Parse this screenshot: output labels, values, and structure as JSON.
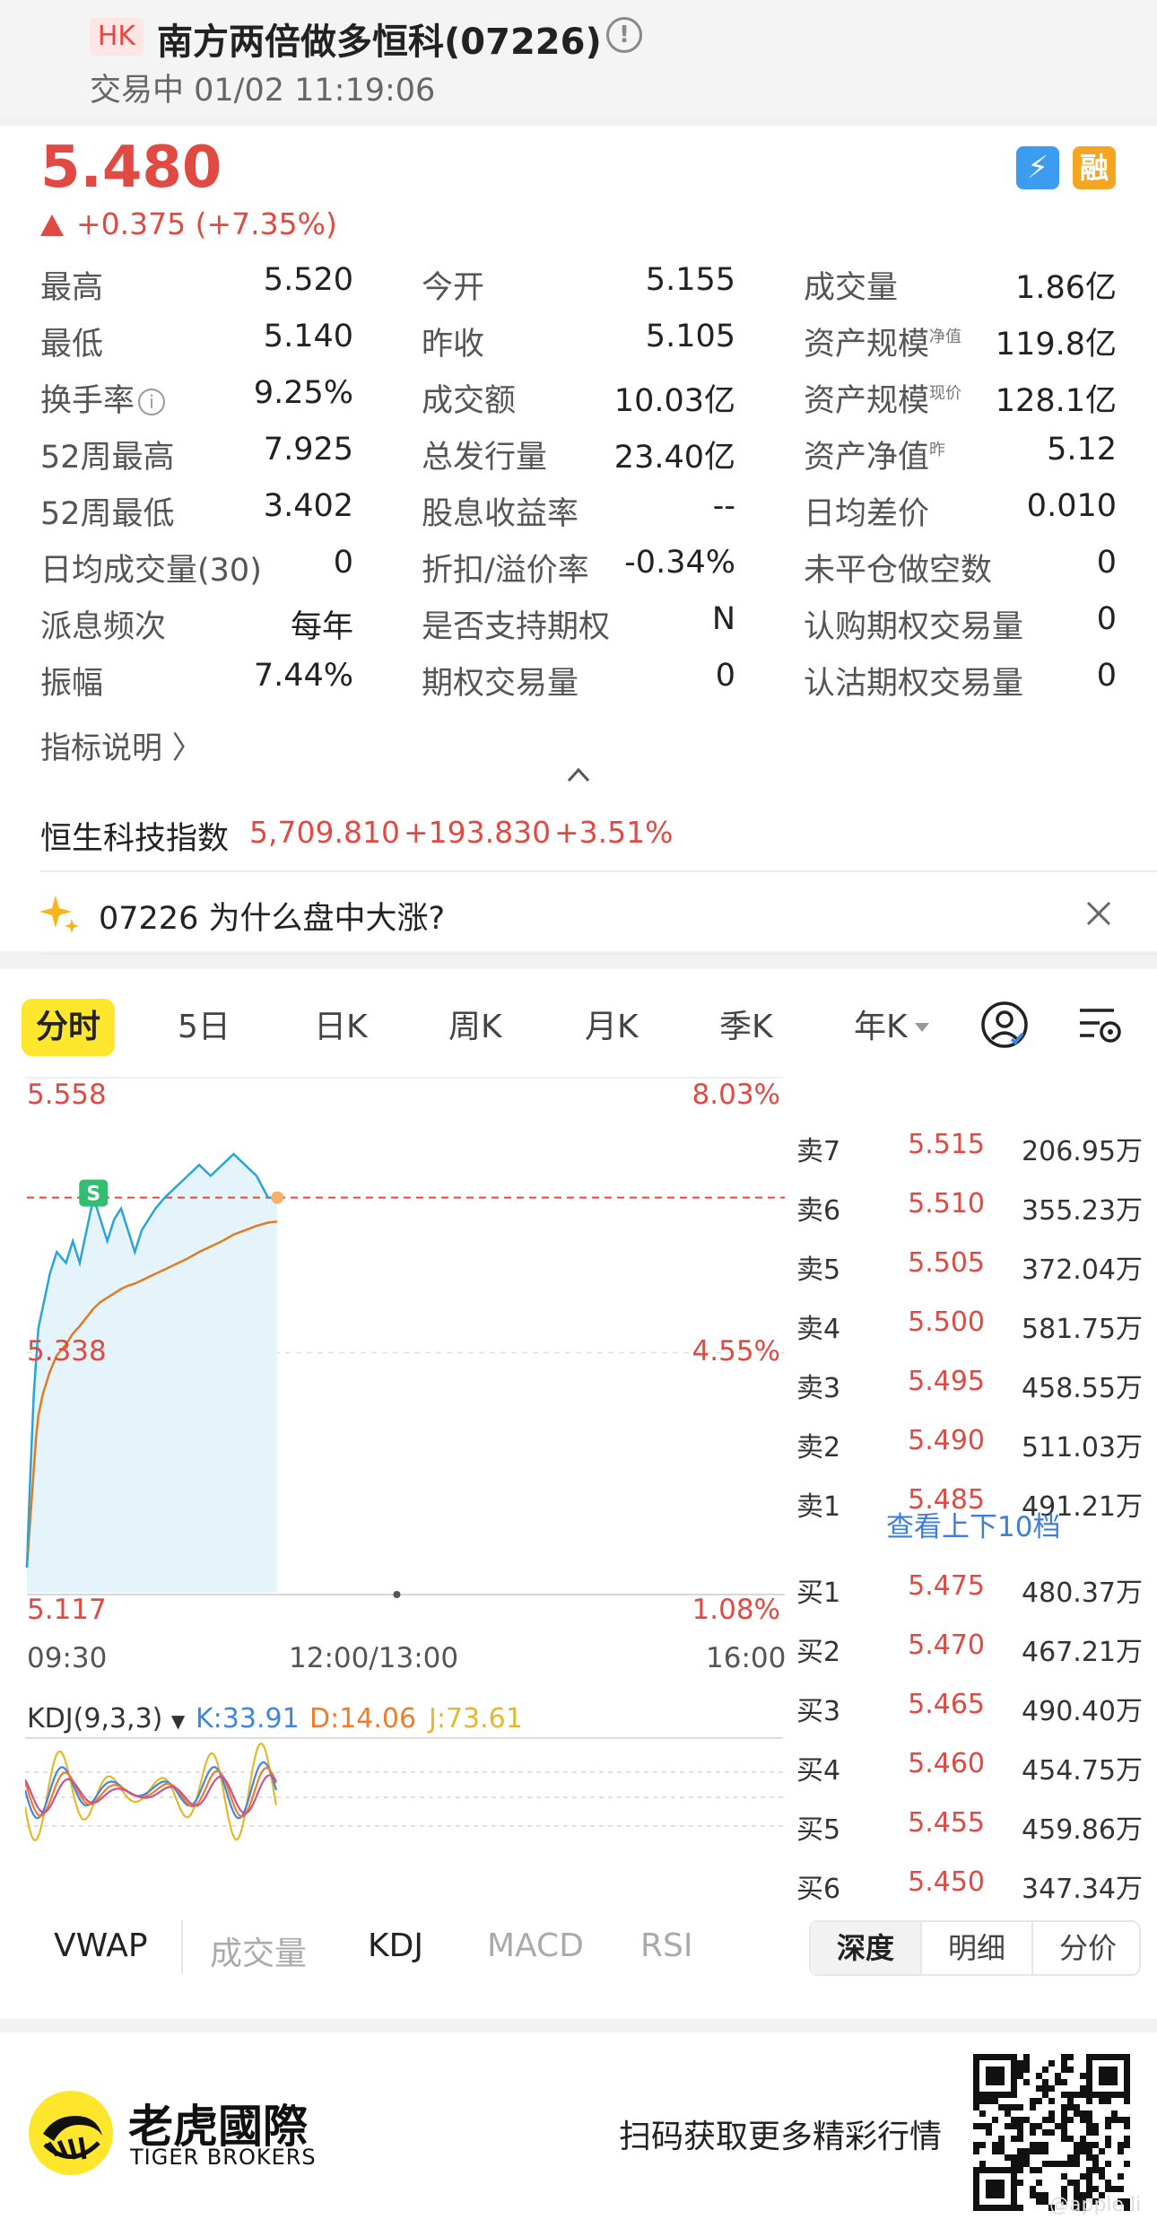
{
  "header": {
    "market_badge": "HK",
    "title": "南方两倍做多恒科(07226)",
    "status_line": "交易中 01/02 11:19:06"
  },
  "quote": {
    "price": "5.480",
    "change": "+0.375 (+7.35%)",
    "badge_lv2": "2",
    "badge_margin": "融"
  },
  "stats": [
    [
      {
        "label": "最高",
        "value": "5.520"
      },
      {
        "label": "今开",
        "value": "5.155"
      },
      {
        "label": "成交量",
        "value": "1.86亿"
      }
    ],
    [
      {
        "label": "最低",
        "value": "5.140"
      },
      {
        "label": "昨收",
        "value": "5.105"
      },
      {
        "label": "资产规模",
        "sup": "净值",
        "value": "119.8亿"
      }
    ],
    [
      {
        "label": "换手率",
        "value": "9.25%"
      },
      {
        "label": "成交额",
        "value": "10.03亿"
      },
      {
        "label": "资产规模",
        "sup": "现价",
        "value": "128.1亿"
      }
    ],
    [
      {
        "label": "52周最高",
        "value": "7.925"
      },
      {
        "label": "总发行量",
        "value": "23.40亿"
      },
      {
        "label": "资产净值",
        "sup": "昨",
        "value": "5.12"
      }
    ],
    [
      {
        "label": "52周最低",
        "value": "3.402"
      },
      {
        "label": "股息收益率",
        "value": "--"
      },
      {
        "label": "日均差价",
        "value": "0.010"
      }
    ],
    [
      {
        "label": "日均成交量(30)",
        "value": "0"
      },
      {
        "label": "折扣/溢价率",
        "value": "-0.34%"
      },
      {
        "label": "未平仓做空数",
        "value": "0"
      }
    ],
    [
      {
        "label": "派息频次",
        "value": "每年"
      },
      {
        "label": "是否支持期权",
        "value": "N"
      },
      {
        "label": "认购期权交易量",
        "value": "0"
      }
    ],
    [
      {
        "label": "振幅",
        "value": "7.44%"
      },
      {
        "label": "期权交易量",
        "value": "0"
      },
      {
        "label": "认沽期权交易量",
        "value": "0"
      }
    ]
  ],
  "explain_link": "指标说明 〉",
  "index_bar": {
    "name": "恒生科技指数",
    "value": "5,709.810",
    "change": "+193.830",
    "pct": "+3.51%"
  },
  "ai_question": "07226 为什么盘中大涨?",
  "chart_tabs": [
    "分时",
    "5日",
    "日K",
    "周K",
    "月K",
    "季K",
    "年K"
  ],
  "chart": {
    "y_left": [
      "5.558",
      "5.338",
      "5.117"
    ],
    "y_right": [
      "8.03%",
      "4.55%",
      "1.08%"
    ],
    "x_labels": [
      "09:30",
      "12:00/13:00",
      "16:00"
    ],
    "marker_label": "S"
  },
  "chart_data": {
    "type": "line",
    "x": [
      "09:30",
      "09:31",
      "09:32",
      "09:33",
      "09:34",
      "09:35",
      "09:37",
      "09:40",
      "09:43",
      "09:47",
      "09:50",
      "09:53",
      "09:56",
      "09:59",
      "10:02",
      "10:05",
      "10:08",
      "10:11",
      "10:14",
      "10:17",
      "10:20",
      "10:23",
      "10:26",
      "10:30",
      "10:35",
      "10:40",
      "10:45",
      "10:50",
      "10:55",
      "11:00",
      "11:05",
      "11:10",
      "11:15",
      "11:19"
    ],
    "series": [
      {
        "name": "price",
        "values": [
          5.14,
          5.2,
          5.25,
          5.3,
          5.33,
          5.36,
          5.38,
          5.41,
          5.43,
          5.42,
          5.44,
          5.42,
          5.45,
          5.48,
          5.46,
          5.44,
          5.46,
          5.47,
          5.45,
          5.43,
          5.45,
          5.46,
          5.47,
          5.48,
          5.49,
          5.5,
          5.51,
          5.5,
          5.51,
          5.52,
          5.51,
          5.5,
          5.48,
          5.48
        ]
      },
      {
        "name": "average",
        "values": [
          5.14,
          5.17,
          5.2,
          5.23,
          5.26,
          5.28,
          5.3,
          5.32,
          5.335,
          5.345,
          5.355,
          5.362,
          5.37,
          5.378,
          5.384,
          5.388,
          5.392,
          5.396,
          5.399,
          5.401,
          5.404,
          5.407,
          5.41,
          5.414,
          5.419,
          5.424,
          5.43,
          5.435,
          5.44,
          5.446,
          5.45,
          5.454,
          5.457,
          5.458
        ]
      }
    ],
    "prev_close": 5.105,
    "ylim": [
      5.117,
      5.558
    ]
  },
  "kdj": {
    "label": "KDJ(9,3,3)",
    "k": "K:33.91",
    "d": "D:14.06",
    "j": "J:73.61"
  },
  "order_book": {
    "asks": [
      {
        "label": "卖7",
        "price": "5.515",
        "vol": "206.95万"
      },
      {
        "label": "卖6",
        "price": "5.510",
        "vol": "355.23万"
      },
      {
        "label": "卖5",
        "price": "5.505",
        "vol": "372.04万"
      },
      {
        "label": "卖4",
        "price": "5.500",
        "vol": "581.75万"
      },
      {
        "label": "卖3",
        "price": "5.495",
        "vol": "458.55万"
      },
      {
        "label": "卖2",
        "price": "5.490",
        "vol": "511.03万"
      },
      {
        "label": "卖1",
        "price": "5.485",
        "vol": "491.21万"
      }
    ],
    "more": "查看上下10档",
    "bids": [
      {
        "label": "买1",
        "price": "5.475",
        "vol": "480.37万"
      },
      {
        "label": "买2",
        "price": "5.470",
        "vol": "467.21万"
      },
      {
        "label": "买3",
        "price": "5.465",
        "vol": "490.40万"
      },
      {
        "label": "买4",
        "price": "5.460",
        "vol": "454.75万"
      },
      {
        "label": "买5",
        "price": "5.455",
        "vol": "459.86万"
      },
      {
        "label": "买6",
        "price": "5.450",
        "vol": "347.34万"
      }
    ]
  },
  "indicator_tabs": [
    "VWAP",
    "成交量",
    "KDJ",
    "MACD",
    "RSI"
  ],
  "seg_tabs": [
    "深度",
    "明细",
    "分价"
  ],
  "footer": {
    "brand": "老虎國際",
    "brand_en": "TIGER BROKERS",
    "cta": "扫码获取更多精彩行情",
    "watermark": "@apple li"
  }
}
